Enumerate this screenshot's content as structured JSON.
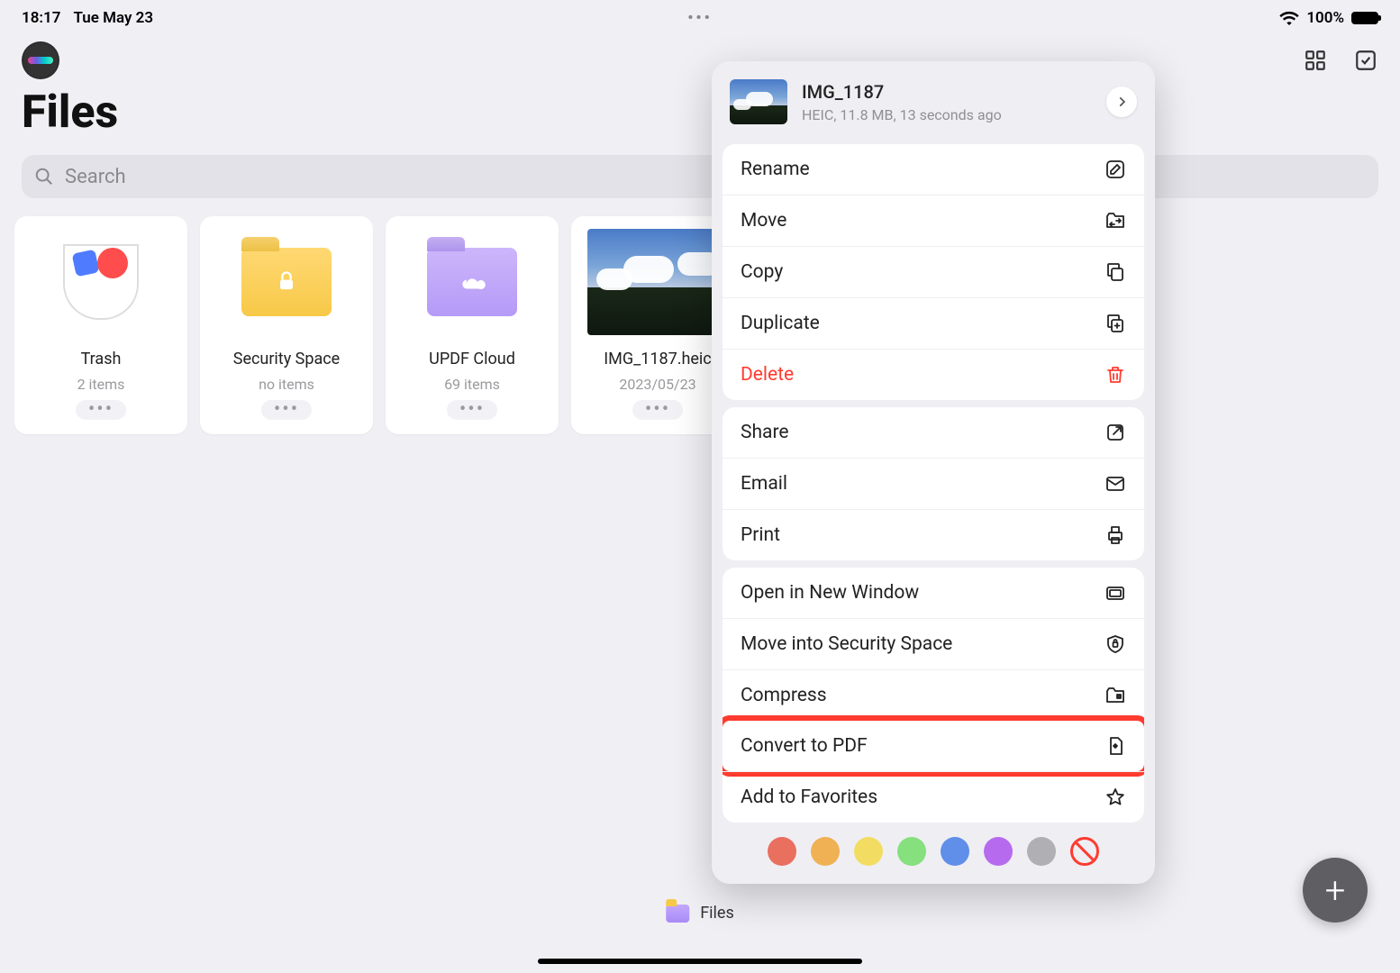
{
  "status": {
    "time": "18:17",
    "date": "Tue May 23",
    "battery_pct": "100%"
  },
  "header": {
    "title": "Files"
  },
  "search": {
    "placeholder": "Search"
  },
  "grid": [
    {
      "name": "Trash",
      "sub": "2 items",
      "kind": "trash"
    },
    {
      "name": "Security Space",
      "sub": "no items",
      "kind": "folder-yellow"
    },
    {
      "name": "UPDF Cloud",
      "sub": "69 items",
      "kind": "folder-purple"
    },
    {
      "name": "IMG_1187.heic",
      "sub": "2023/05/23",
      "kind": "photo"
    }
  ],
  "bottom": {
    "label": "Files"
  },
  "popover": {
    "file_name": "IMG_1187",
    "file_meta": "HEIC, 11.8 MB, 13 seconds ago",
    "groups": [
      [
        {
          "label": "Rename",
          "icon": "rename",
          "danger": false
        },
        {
          "label": "Move",
          "icon": "move",
          "danger": false
        },
        {
          "label": "Copy",
          "icon": "copy",
          "danger": false
        },
        {
          "label": "Duplicate",
          "icon": "duplicate",
          "danger": false
        },
        {
          "label": "Delete",
          "icon": "trash",
          "danger": true
        }
      ],
      [
        {
          "label": "Share",
          "icon": "share",
          "danger": false
        },
        {
          "label": "Email",
          "icon": "mail",
          "danger": false
        },
        {
          "label": "Print",
          "icon": "print",
          "danger": false
        }
      ],
      [
        {
          "label": "Open in New Window",
          "icon": "window",
          "danger": false
        },
        {
          "label": "Move into Security Space",
          "icon": "shield",
          "danger": false
        },
        {
          "label": "Compress",
          "icon": "zip",
          "danger": false
        },
        {
          "label": "Convert to PDF",
          "icon": "pdf",
          "danger": false,
          "highlight": true
        },
        {
          "label": "Add to Favorites",
          "icon": "star",
          "danger": false
        }
      ]
    ],
    "tags": [
      "#e96f5f",
      "#efb153",
      "#f2dd62",
      "#86e07d",
      "#5f8fe8",
      "#b66bef",
      "#b0b0b4"
    ]
  }
}
